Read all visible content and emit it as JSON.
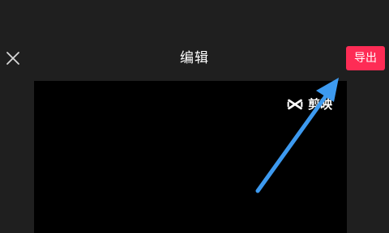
{
  "header": {
    "title": "编辑",
    "close_icon": "close-icon",
    "export_label": "导出"
  },
  "preview": {
    "watermark_text": "剪映",
    "watermark_icon": "capcut-logo-icon"
  },
  "colors": {
    "background": "#1f1f1f",
    "export_accent": "#fe2c55",
    "arrow": "#3d9af0"
  }
}
